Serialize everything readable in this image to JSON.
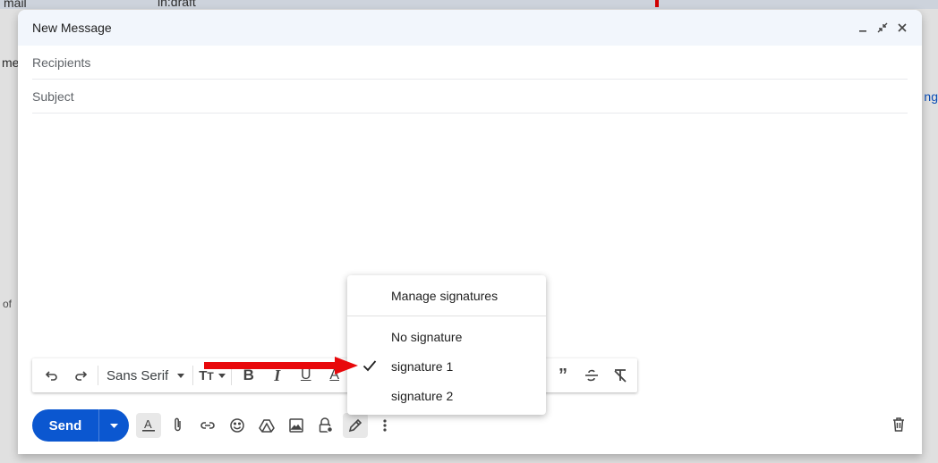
{
  "background": {
    "app_fragment": "mail",
    "search_fragment": "in:draft",
    "side_fragment": "me",
    "pagination_fragment": "of",
    "right_link_fragment": "ng"
  },
  "compose": {
    "title": "New Message",
    "recipients_placeholder": "Recipients",
    "subject_placeholder": "Subject",
    "header_buttons": [
      "minimize-icon",
      "fullscreen-icon",
      "close-icon"
    ]
  },
  "toolbar": {
    "font_name": "Sans Serif",
    "bold": "B",
    "italic": "I",
    "underline": "U",
    "text_color": "A"
  },
  "bottom_bar": {
    "send_label": "Send",
    "send_color": "#0b57d0"
  },
  "signature_menu": {
    "manage": "Manage signatures",
    "items": [
      {
        "label": "No signature",
        "checked": false
      },
      {
        "label": "signature 1",
        "checked": true
      },
      {
        "label": "signature 2",
        "checked": false
      }
    ]
  },
  "annotation": {
    "arrow_color": "#e8080b"
  }
}
